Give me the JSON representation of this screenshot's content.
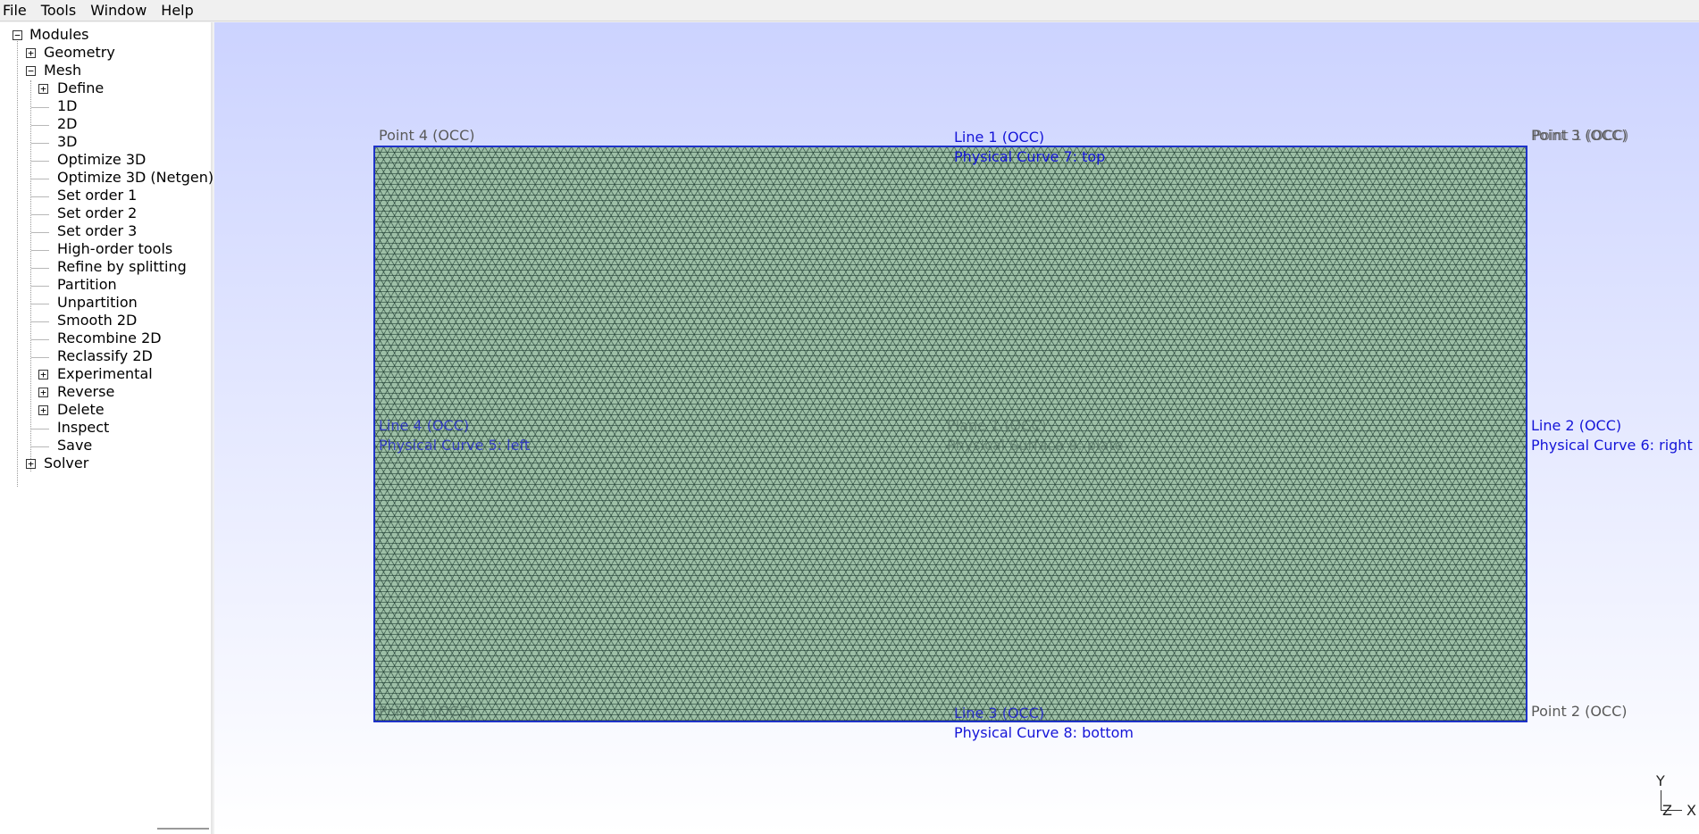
{
  "menubar": {
    "items": [
      {
        "label": "File"
      },
      {
        "label": "Tools"
      },
      {
        "label": "Window"
      },
      {
        "label": "Help"
      }
    ]
  },
  "tree": {
    "modules": "Modules",
    "geometry": "Geometry",
    "mesh": "Mesh",
    "mesh_items": [
      {
        "label": "Define",
        "expandable": true
      },
      {
        "label": "1D"
      },
      {
        "label": "2D"
      },
      {
        "label": "3D"
      },
      {
        "label": "Optimize 3D"
      },
      {
        "label": "Optimize 3D (Netgen)"
      },
      {
        "label": "Set order 1"
      },
      {
        "label": "Set order 2"
      },
      {
        "label": "Set order 3"
      },
      {
        "label": "High-order tools"
      },
      {
        "label": "Refine by splitting"
      },
      {
        "label": "Partition"
      },
      {
        "label": "Unpartition"
      },
      {
        "label": "Smooth 2D"
      },
      {
        "label": "Recombine 2D"
      },
      {
        "label": "Reclassify 2D"
      },
      {
        "label": "Experimental",
        "expandable": true
      },
      {
        "label": "Reverse",
        "expandable": true
      },
      {
        "label": "Delete",
        "expandable": true
      },
      {
        "label": "Inspect"
      },
      {
        "label": "Save"
      }
    ],
    "solver": "Solver",
    "expanded_symbol": "−",
    "collapsed_symbol": "+"
  },
  "viewport": {
    "point4": "Point 4 (OCC)",
    "line1": "Line 1 (OCC)",
    "curve7": "Physical Curve 7: top",
    "point1_overlap": "Point 1 (OCC)",
    "line4": "Line 4 (OCC)",
    "curve5": "Physical Curve 5: left",
    "plane1": "Plane 1 (OCC)",
    "surface9": "Physical Surface 9: plate",
    "line2": "Line 2 (OCC)",
    "curve6": "Physical Curve 6: right",
    "point3": "Point 3 (OCC)",
    "line3": "Line 3 (OCC)",
    "curve8": "Physical Curve 8: bottom",
    "point2": "Point 2 (OCC)",
    "axis_y": "Y",
    "axis_z": "Z",
    "axis_x": "X",
    "colors": {
      "background_top": "#ccd3ff",
      "mesh_fill": "#9dbfa6",
      "boundary": "#1e32c8",
      "label_blue": "#1515d8",
      "label_gray": "#5a5a5a"
    }
  }
}
